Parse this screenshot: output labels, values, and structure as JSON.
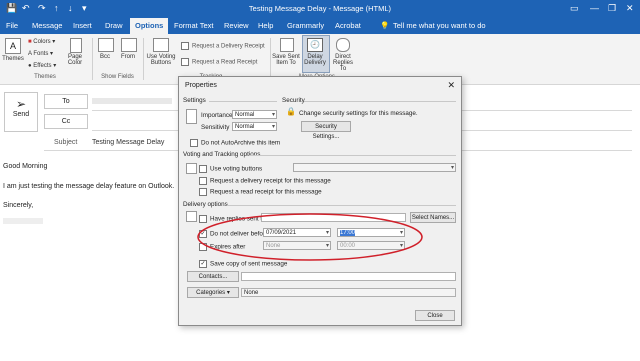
{
  "window": {
    "title": "Testing Message Delay  -  Message (HTML)"
  },
  "tabs": [
    "File",
    "Message",
    "Insert",
    "Draw",
    "Options",
    "Format Text",
    "Review",
    "Help",
    "Grammarly",
    "Acrobat"
  ],
  "active_tab": "Options",
  "tell_me": "Tell me what you want to do",
  "ribbon": {
    "themes": "Themes",
    "colors": "Colors",
    "fonts": "Fonts",
    "effects": "Effects",
    "page_color": "Page Color",
    "themes_group": "Themes",
    "bcc": "Bcc",
    "from": "From",
    "show_fields_group": "Show Fields",
    "use_voting": "Use Voting Buttons",
    "request_delivery": "Request a Delivery Receipt",
    "request_read": "Request a Read Receipt",
    "tracking_group": "Tracking",
    "save_sent": "Save Sent Item To",
    "delay_delivery": "Delay Delivery",
    "direct_replies": "Direct Replies To",
    "more_options_group": "More Options"
  },
  "compose": {
    "send": "Send",
    "to": "To",
    "cc": "Cc",
    "subject_label": "Subject",
    "subject_value": "Testing Message Delay",
    "body": [
      "Good Morning",
      "I am just testing the message delay feature on Outlook.",
      "Sincerely,"
    ]
  },
  "dialog": {
    "title": "Properties",
    "settings": "Settings",
    "importance_label": "Importance",
    "importance_value": "Normal",
    "sensitivity_label": "Sensitivity",
    "sensitivity_value": "Normal",
    "security": "Security",
    "security_text": "Change security settings for this message.",
    "security_button": "Security Settings...",
    "no_autoarchive": "Do not AutoArchive this item",
    "voting_section": "Voting and Tracking options",
    "use_voting": "Use voting buttons",
    "request_delivery": "Request a delivery receipt for this message",
    "request_read": "Request a read receipt for this message",
    "delivery_section": "Delivery options",
    "have_replies": "Have replies sent to",
    "select_names": "Select Names...",
    "do_not_deliver": "Do not deliver before",
    "deliver_date": "07/09/2021",
    "deliver_time": "17:00",
    "expires_after": "Expires after",
    "expires_date": "None",
    "expires_time": "00:00",
    "save_copy": "Save copy of sent message",
    "contacts": "Contacts...",
    "categories": "Categories",
    "categories_value": "None",
    "close": "Close"
  },
  "colors": {
    "title_bar": "#1e63b5",
    "annotation": "#d0202a"
  }
}
